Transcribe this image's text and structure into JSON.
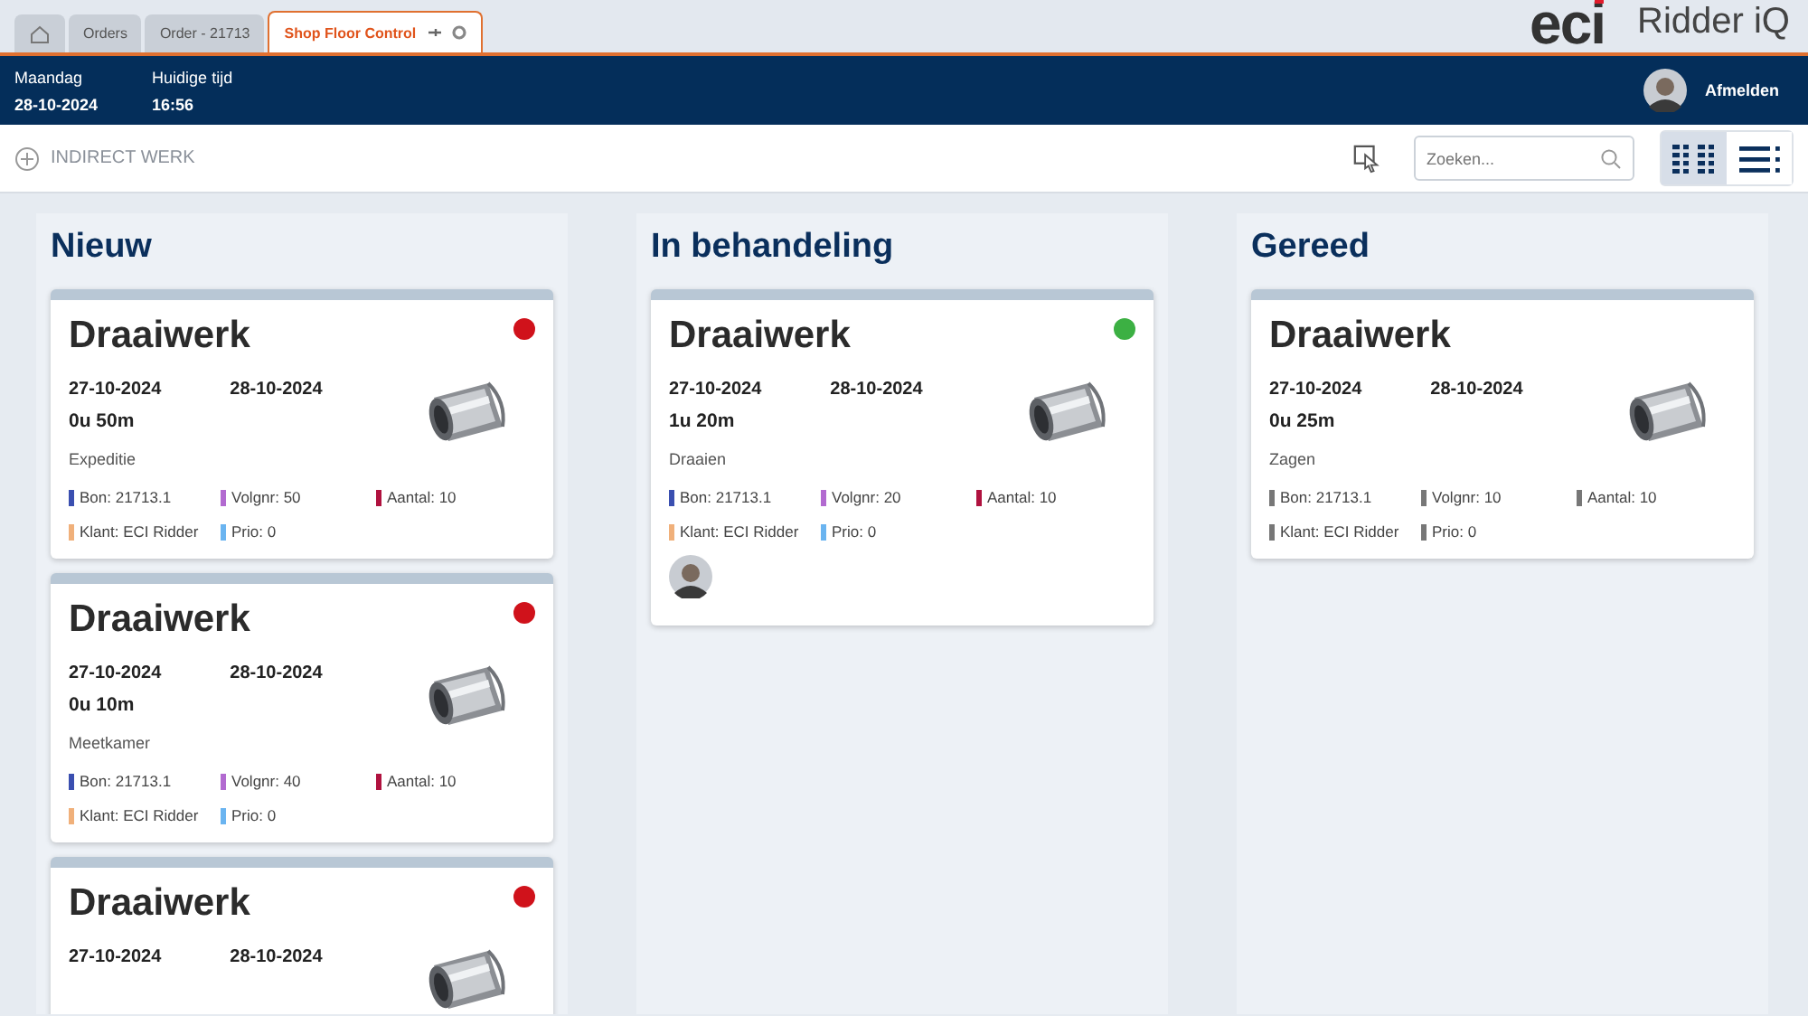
{
  "tabs": [
    {
      "kind": "home",
      "selected": false
    },
    {
      "label": "Orders",
      "selected": false
    },
    {
      "label": "Order - 21713",
      "selected": false
    },
    {
      "label": "Shop Floor Control",
      "selected": true
    }
  ],
  "logos": {
    "brand": "eci",
    "product": "Ridder iQ"
  },
  "header": {
    "day_label": "Maandag",
    "date": "28-10-2024",
    "time_label": "Huidige tijd",
    "time": "16:56",
    "logout": "Afmelden"
  },
  "toolbar": {
    "indirect_button": "INDIRECT WERK",
    "search": {
      "placeholder": "Zoeken..."
    },
    "views": [
      {
        "kind": "board",
        "selected": true
      },
      {
        "kind": "list",
        "selected": false
      }
    ]
  },
  "columns": [
    {
      "title": "Nieuw",
      "cards": [
        {
          "title": "Draaiwerk",
          "color": "#d0121b",
          "start": "27-10-2024",
          "end": "28-10-2024",
          "duration": "0u 50m",
          "location": "Expeditie",
          "tags": [
            {
              "text": "Bon: 21713.1",
              "color": "#3a4fb0"
            },
            {
              "text": "Volgnr: 50",
              "color": "#b26ad0"
            },
            {
              "text": "Aantal: 10",
              "color": "#b0123f"
            },
            {
              "text": "Klant: ECI Ridder",
              "color": "#f0b07a"
            },
            {
              "text": "Prio: 0",
              "color": "#6ab4f0"
            }
          ]
        },
        {
          "title": "Draaiwerk",
          "color": "#d0121b",
          "start": "27-10-2024",
          "end": "28-10-2024",
          "duration": "0u 10m",
          "location": "Meetkamer",
          "tags": [
            {
              "text": "Bon: 21713.1",
              "color": "#3a4fb0"
            },
            {
              "text": "Volgnr: 40",
              "color": "#b26ad0"
            },
            {
              "text": "Aantal: 10",
              "color": "#b0123f"
            },
            {
              "text": "Klant: ECI Ridder",
              "color": "#f0b07a"
            },
            {
              "text": "Prio: 0",
              "color": "#6ab4f0"
            }
          ]
        },
        {
          "title": "Draaiwerk",
          "color": "#d0121b",
          "start": "27-10-2024",
          "end": "28-10-2024"
        }
      ]
    },
    {
      "title": "In behandeling",
      "cards": [
        {
          "title": "Draaiwerk",
          "color": "#3cb043",
          "start": "27-10-2024",
          "end": "28-10-2024",
          "duration": "1u 20m",
          "location": "Draaien",
          "tags": [
            {
              "text": "Bon: 21713.1",
              "color": "#3a4fb0"
            },
            {
              "text": "Volgnr: 20",
              "color": "#b26ad0"
            },
            {
              "text": "Aantal: 10",
              "color": "#b0123f"
            },
            {
              "text": "Klant: ECI Ridder",
              "color": "#f0b07a"
            },
            {
              "text": "Prio: 0",
              "color": "#6ab4f0"
            }
          ],
          "assignee": true
        }
      ]
    },
    {
      "title": "Gereed",
      "cards": [
        {
          "title": "Draaiwerk",
          "start": "27-10-2024",
          "end": "28-10-2024",
          "duration": "0u 25m",
          "location": "Zagen",
          "tags": [
            {
              "text": "Bon: 21713.1",
              "color": "#777777"
            },
            {
              "text": "Volgnr: 10",
              "color": "#777777"
            },
            {
              "text": "Aantal: 10",
              "color": "#777777"
            },
            {
              "text": "Klant: ECI Ridder",
              "color": "#777777"
            },
            {
              "text": "Prio: 0",
              "color": "#777777"
            }
          ]
        }
      ]
    }
  ]
}
